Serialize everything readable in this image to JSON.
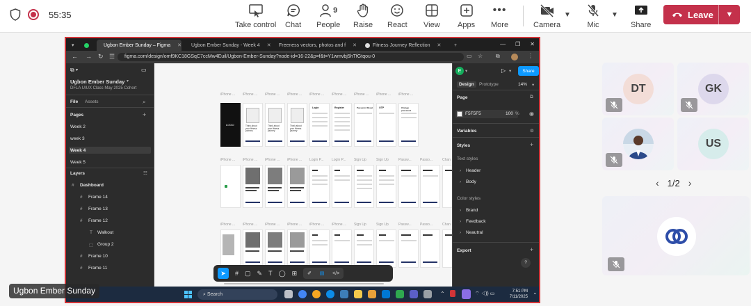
{
  "meeting": {
    "timer": "55:35",
    "toolbar": [
      {
        "label": "Take control",
        "icon": "take-control-icon"
      },
      {
        "label": "Chat",
        "icon": "chat-icon"
      },
      {
        "label": "People",
        "icon": "people-icon",
        "count": "9"
      },
      {
        "label": "Raise",
        "icon": "hand-icon"
      },
      {
        "label": "React",
        "icon": "smiley-icon"
      },
      {
        "label": "View",
        "icon": "view-grid-icon"
      },
      {
        "label": "Apps",
        "icon": "apps-plus-icon"
      },
      {
        "label": "More",
        "icon": "more-dots-icon"
      }
    ],
    "camera_label": "Camera",
    "mic_label": "Mic",
    "share_label": "Share",
    "leave_label": "Leave",
    "presenter_name": "Ugbon Ember Sunday"
  },
  "participants": {
    "tiles": [
      {
        "initials": "DT",
        "color": "#f3ddd7",
        "muted": true
      },
      {
        "initials": "GK",
        "color": "#ddd8ec",
        "muted": true
      },
      {
        "initials": "",
        "photo": true,
        "muted": true
      },
      {
        "initials": "US",
        "color": "#d6eceb",
        "muted": false
      }
    ],
    "pager": "1/2"
  },
  "browser": {
    "tabs": [
      {
        "title": "Ugbon Ember Sunday – Figma",
        "active": true
      },
      {
        "title": "Ugbon Ember Sunday - Week 4",
        "active": false
      },
      {
        "title": "Freeness vectors, photos and f",
        "active": false
      },
      {
        "title": "Fitness Journey Reflection",
        "active": false
      }
    ],
    "url": "figma.com/design/omf9KC18GSqC7ccMw4Euil/Ugbon-Ember-Sunday?node-id=16-22&p=f&t=Y1wmvbj5hTfGtqou-0"
  },
  "figma": {
    "file_name": "Ugbon Ember Sunday",
    "team": "DFLA UIUX Class May 2025 Cohort",
    "left_tabs": {
      "file": "File",
      "assets": "Assets"
    },
    "pages_label": "Pages",
    "pages": [
      "Week 2",
      "week 3",
      "Week 4",
      "Week 5"
    ],
    "layers_label": "Layers",
    "layers": [
      "Dashboard",
      "Frame 14",
      "Frame 13",
      "Frame 12",
      "Walkout",
      "Group 2",
      "Frame 10",
      "Frame 11"
    ],
    "right": {
      "avatar": "E",
      "share": "Share",
      "tabs": {
        "design": "Design",
        "prototype": "Prototype"
      },
      "zoom": "14%",
      "page_label": "Page",
      "page_color": "F5F5F5",
      "page_opacity": "100",
      "pct": "%",
      "variables_label": "Variables",
      "styles_label": "Styles",
      "text_styles_label": "Text styles",
      "text_styles": [
        "Header",
        "Body"
      ],
      "color_styles_label": "Color styles",
      "color_styles": [
        "Brand",
        "Feedback",
        "Neautral"
      ],
      "export_label": "Export",
      "help": "?"
    },
    "canvas": {
      "row1_labels": [
        "iPhone ...",
        "iPhone ...",
        "iPhone ...",
        "iPhone ...",
        "iPhone ...",
        "iPhone ...",
        "iPhone ...",
        "iPhone ...",
        "iPhone ..."
      ],
      "row2_labels": [
        "iPhone ...",
        "iPhone ...",
        "iPhone ...",
        "iPhone ...",
        "Login P...",
        "Login P...",
        "Sign Up",
        "Sign Up",
        "Passw...",
        "Passo...",
        "Chan"
      ],
      "row3_labels": [
        "iPhone ...",
        "iPhone ...",
        "iPhone ...",
        "iPhone ...",
        "iPhone ...",
        "iPhone ...",
        "Sign Up",
        "Sign Up",
        "Passw...",
        "Passo...",
        "Chan"
      ],
      "logo_text": "LOGO",
      "screen_texts": [
        "Login",
        "Register",
        "Password Reset",
        "OTP",
        "Change password"
      ],
      "tagline": "Think about your fitness journey"
    }
  },
  "taskbar": {
    "search": "Search",
    "time": "7:51 PM",
    "date": "7/11/2025"
  }
}
